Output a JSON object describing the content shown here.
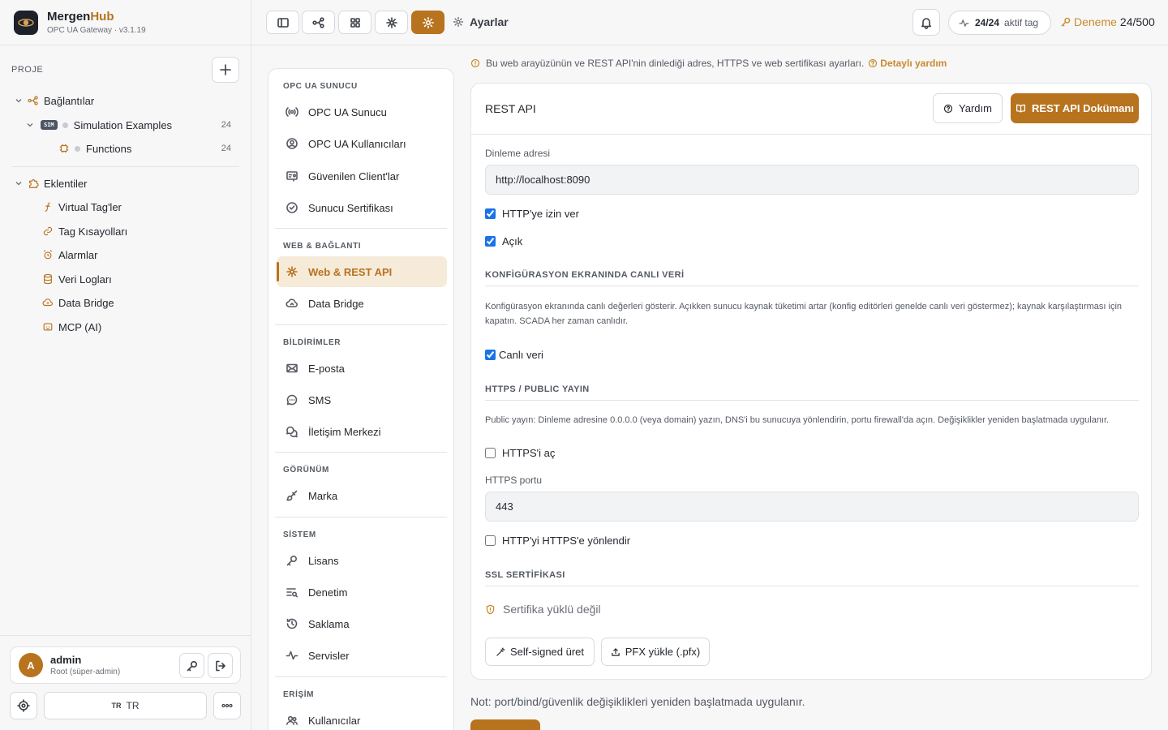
{
  "brand": {
    "name_main": "Mergen",
    "name_accent": "Hub",
    "subtitle": "OPC UA Gateway · v3.1.19"
  },
  "sidebar": {
    "project_label": "PROJE",
    "tree": [
      {
        "label": "Bağlantılar",
        "icon": "connections-icon"
      },
      {
        "label": "Simulation Examples",
        "badge": "SIM",
        "count": "24"
      },
      {
        "label": "Functions",
        "count": "24",
        "icon": "chip-icon"
      }
    ],
    "plugins_label": "Eklentiler",
    "plugins": [
      {
        "label": "Virtual Tag'ler",
        "icon": "function-icon"
      },
      {
        "label": "Tag Kısayolları",
        "icon": "link-icon"
      },
      {
        "label": "Alarmlar",
        "icon": "alarm-icon"
      },
      {
        "label": "Veri Logları",
        "icon": "database-icon"
      },
      {
        "label": "Data Bridge",
        "icon": "cloud-sync-icon"
      },
      {
        "label": "MCP (AI)",
        "icon": "ai-icon"
      }
    ],
    "user": {
      "initial": "A",
      "name": "admin",
      "role": "Root (süper-admin)"
    },
    "language": {
      "code": "TR",
      "label": "TR"
    }
  },
  "topbar": {
    "title": "Ayarlar",
    "tag_count": "24/24",
    "tag_label": "aktif tag",
    "trial_label": "Deneme",
    "trial_count": "24/500"
  },
  "settings_nav": {
    "groups": [
      {
        "heading": "OPC UA SUNUCU",
        "items": [
          "OPC UA Sunucu",
          "OPC UA Kullanıcıları",
          "Güvenilen Client'lar",
          "Sunucu Sertifikası"
        ]
      },
      {
        "heading": "WEB & BAĞLANTI",
        "items": [
          "Web & REST API",
          "Data Bridge"
        ]
      },
      {
        "heading": "BİLDİRİMLER",
        "items": [
          "E-posta",
          "SMS",
          "İletişim Merkezi"
        ]
      },
      {
        "heading": "GÖRÜNÜM",
        "items": [
          "Marka"
        ]
      },
      {
        "heading": "SİSTEM",
        "items": [
          "Lisans",
          "Denetim",
          "Saklama",
          "Servisler"
        ]
      },
      {
        "heading": "ERİŞİM",
        "items": [
          "Kullanıcılar"
        ]
      }
    ],
    "active": "Web & REST API"
  },
  "content": {
    "info": "Bu web arayüzünün ve REST API'nin dinlediği adres, HTTPS ve web sertifikası ayarları.",
    "help_link": "Detaylı yardım",
    "card_title": "REST API",
    "help_button": "Yardım",
    "docs_button": "REST API Dokümanı",
    "listen_label": "Dinleme adresi",
    "listen_value": "http://localhost:8090",
    "allow_http": "HTTP'ye izin ver",
    "open": "Açık",
    "live_section": "KONFİGÜRASYON EKRANINDA CANLI VERİ",
    "live_desc": "Konfigürasyon ekranında canlı değerleri gösterir. Açıkken sunucu kaynak tüketimi artar (konfig editörleri genelde canlı veri göstermez); kaynak karşılaştırması için kapatın. SCADA her zaman canlıdır.",
    "live_data": "Canlı veri",
    "https_section": "HTTPS / PUBLIC YAYIN",
    "https_desc": "Public yayın: Dinleme adresine 0.0.0.0 (veya domain) yazın, DNS'i bu sunucuya yönlendirin, portu firewall'da açın. Değişiklikler yeniden başlatmada uygulanır.",
    "https_open": "HTTPS'i aç",
    "https_port_label": "HTTPS portu",
    "https_port_value": "443",
    "redirect": "HTTP'yi HTTPS'e yönlendir",
    "ssl_section": "SSL SERTİFİKASI",
    "cert_status": "Sertifika yüklü değil",
    "self_signed": "Self-signed üret",
    "pfx_upload": "PFX yükle (.pfx)",
    "note": "Not: port/bind/güvenlik değişiklikleri yeniden başlatmada uygulanır."
  },
  "colors": {
    "accent": "#b7731d",
    "accent_soft": "#f6ead9"
  }
}
